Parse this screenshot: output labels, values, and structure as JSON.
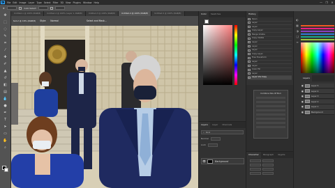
{
  "app": {
    "logo": "Ps",
    "menu": [
      "File",
      "Edit",
      "Image",
      "Layer",
      "Type",
      "Select",
      "Filter",
      "3D",
      "View",
      "Plugins",
      "Window",
      "Help"
    ],
    "window_buttons": [
      "—",
      "❐",
      "✕"
    ]
  },
  "options_bar": {
    "size_value": "",
    "mode_label": "Auto Select",
    "style_label": "Style:",
    "style_value": "Normal",
    "select_mask_label": "Select and Mask..."
  },
  "doc_tabs": [
    {
      "label": "Untitled-1 @ 100% (RGB/8)",
      "active": false
    },
    {
      "label": "Untitled-2 @ 100% (Layer 1, RGB/8)",
      "active": false
    },
    {
      "label": "Untitled-3 @ 100% (RGB/8)",
      "active": false
    },
    {
      "label": "Untitled-4 @ 100% (RGB/8)",
      "active": true
    },
    {
      "label": "Untitled-5 @ 100% (RGB/8)",
      "active": false
    }
  ],
  "canvas": {
    "tag": "ted-2 @ 16% (RGB/8)",
    "style_label": "Style:",
    "style_value": "Normal",
    "select_mask": "Select and Mask..."
  },
  "color_panel": {
    "tabs": [
      "Color",
      "Swatches"
    ]
  },
  "layers_mid": {
    "tabs": [
      "Layers",
      "Layer",
      "Channels"
    ],
    "search": "Kind",
    "row1": "Normal",
    "row2": "Lock",
    "background_layer": "Background"
  },
  "history": {
    "title": "History",
    "items": [
      "Open",
      "Layer",
      "Layer",
      "Copy Layer",
      "Merge Visible",
      "Copy Visible",
      "Layer",
      "Layer",
      "Layer",
      "Copy Layer",
      "Free Transform",
      "Layer",
      "Layer",
      "Color Fill",
      "Layer",
      "Layer Via Copy"
    ],
    "selected_index": 15
  },
  "dialog": {
    "title": "Combine Dev Of Buri"
  },
  "character_panel": {
    "tabs": [
      "Character",
      "Paragraph",
      "Glyphs"
    ]
  },
  "right_panel": {
    "layers_title": "Layers",
    "layers": [
      "Layer 5",
      "Layer 4",
      "Layer 3",
      "Layer 2",
      "Layer 1",
      "Background"
    ]
  },
  "colors": {
    "accent": "#31a8ff",
    "panel": "#323232",
    "toolbar": "#535353"
  }
}
